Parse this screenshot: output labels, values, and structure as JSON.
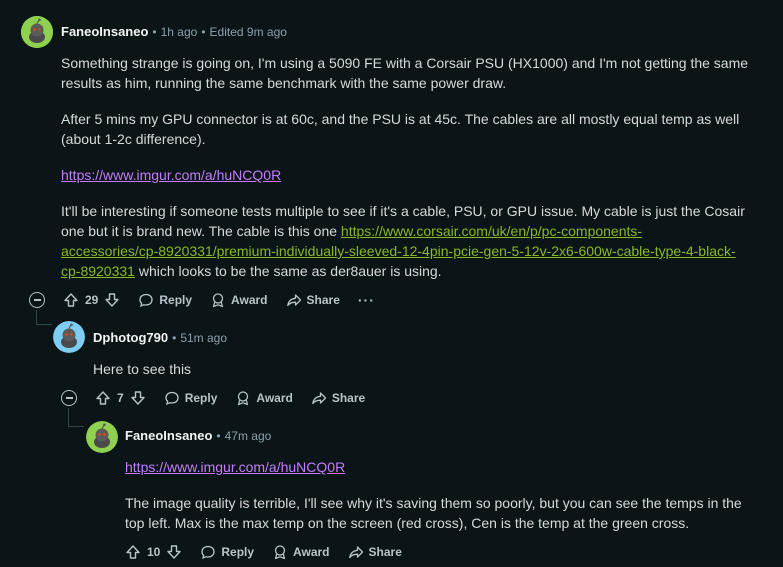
{
  "comments": [
    {
      "username": "FaneoInsaneo",
      "time": "1h ago",
      "edited": "Edited 9m ago",
      "paragraphs": [
        "Something strange is going on, I'm using a 5090 FE with a Corsair PSU (HX1000) and I'm not getting the same results as him, running the same benchmark with the same power draw.",
        "After 5 mins my GPU connector is at 60c, and the PSU is at 45c. The cables are all mostly equal temp as well (about 1-2c difference)."
      ],
      "link1": "https://www.imgur.com/a/huNCQ0R",
      "p3_before": "It'll be interesting if someone tests multiple to see if it's a cable, PSU, or GPU issue. My cable is just the Cosair one but it is brand new. The cable is this one ",
      "p3_link_line1": "https://www.corsair.com/uk/en/p/pc-components-",
      "p3_link_line2": "accessories/cp-8920331/premium-individually-sleeved-12-4pin-pcie-gen-5-12v-2x6-600w-cable-type-4-black-",
      "p3_link_line3": "cp-8920331",
      "p3_after": " which looks to be the same as der8auer is using.",
      "score": "29"
    },
    {
      "username": "Dphotog790",
      "time": "51m ago",
      "text": "Here to see this",
      "score": "7"
    },
    {
      "username": "FaneoInsaneo",
      "time": "47m ago",
      "link": "https://www.imgur.com/a/huNCQ0R",
      "text": "The image quality is terrible, I'll see why it's saving them so poorly, but you can see the temps in the top left. Max is the max temp on the screen (red cross), Cen is the temp at the green cross.",
      "score": "10"
    }
  ],
  "actions": {
    "reply": "Reply",
    "award": "Award",
    "share": "Share",
    "more": "···",
    "separator": "•"
  },
  "colors": {
    "background": "#0b1416",
    "link_purple": "#c37cff",
    "link_green": "#89b926",
    "avatar_green": "#8fd14f"
  },
  "icons": [
    "snoo-avatar-icon",
    "upvote-icon",
    "downvote-icon",
    "reply-bubble-icon",
    "award-icon",
    "share-arrow-icon",
    "collapse-icon",
    "more-options-icon"
  ]
}
